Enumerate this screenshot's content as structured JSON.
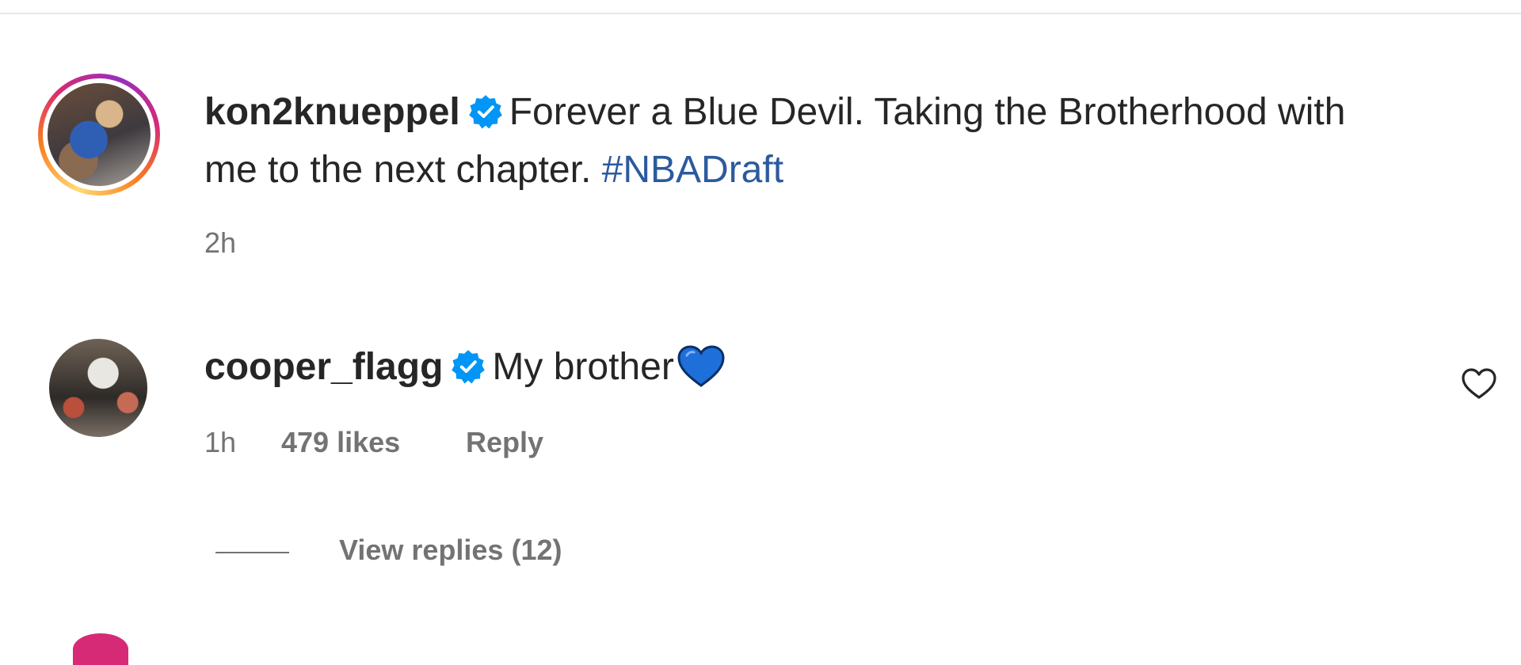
{
  "post": {
    "username": "kon2knueppel",
    "caption_line1": "Forever a Blue Devil. Taking the Brotherhood with",
    "caption_line2": "me to the next chapter.",
    "hashtag": "#NBADraft",
    "time": "2h"
  },
  "comment": {
    "username": "cooper_flagg",
    "text": "My brother",
    "emoji": "blue-heart",
    "time": "1h",
    "likes": "479 likes",
    "reply_label": "Reply",
    "view_replies_label": "View replies (12)"
  },
  "colors": {
    "verified": "#0095f6",
    "hashtag": "#2b5a9e",
    "muted_text": "#737373",
    "blue_heart": "#1e6fd9"
  }
}
